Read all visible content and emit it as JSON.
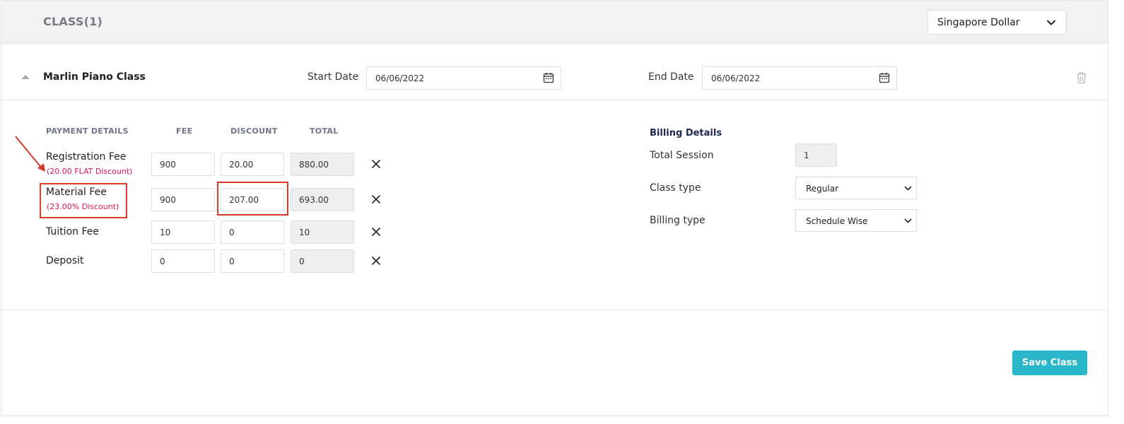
{
  "header": {
    "class_heading": "CLASS(1)",
    "currency": "Singapore Dollar"
  },
  "class_row": {
    "name": "Marlin Piano Class",
    "start_label": "Start Date",
    "start_value": "06/06/2022",
    "end_label": "End Date",
    "end_value": "06/06/2022"
  },
  "payment": {
    "headers": {
      "details": "PAYMENT DETAILS",
      "fee": "FEE",
      "discount": "DISCOUNT",
      "total": "TOTAL"
    },
    "rows": [
      {
        "label": "Registration Fee",
        "note": "(20.00 FLAT Discount)",
        "fee": "900",
        "discount": "20.00",
        "total": "880.00"
      },
      {
        "label": "Material Fee",
        "note": "(23.00% Discount)",
        "fee": "900",
        "discount": "207.00",
        "total": "693.00"
      },
      {
        "label": "Tuition Fee",
        "note": "",
        "fee": "10",
        "discount": "0",
        "total": "10"
      },
      {
        "label": "Deposit",
        "note": "",
        "fee": "0",
        "discount": "0",
        "total": "0"
      }
    ]
  },
  "billing": {
    "title": "Billing Details",
    "total_session_label": "Total Session",
    "total_session_value": "1",
    "class_type_label": "Class type",
    "class_type_value": "Regular",
    "billing_type_label": "Billing type",
    "billing_type_value": "Schedule Wise"
  },
  "actions": {
    "save_label": "Save Class"
  },
  "colors": {
    "accent": "#29b6c8",
    "discount_note": "#e0165e",
    "highlight": "#d63a2a"
  }
}
